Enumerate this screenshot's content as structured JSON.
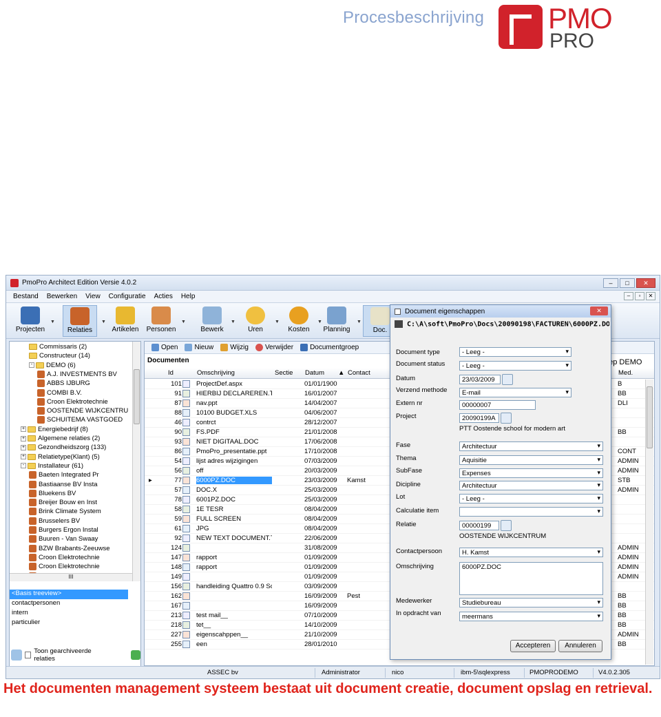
{
  "header": {
    "doc_title": "Procesbeschrijving",
    "logo_top": "PMO",
    "logo_bottom": "PRO"
  },
  "window": {
    "title": "PmoPro Architect Edition Versie 4.0.2"
  },
  "menu": [
    "Bestand",
    "Bewerken",
    "View",
    "Configuratie",
    "Acties",
    "Help"
  ],
  "toolbar": [
    "Projecten",
    "Relaties",
    "Artikelen",
    "Personen",
    "Bewerk",
    "Uren",
    "Kosten",
    "Planning",
    "Doc."
  ],
  "tree": [
    {
      "label": "Commissaris (2)",
      "type": "folder",
      "indent": 2
    },
    {
      "label": "Constructeur (14)",
      "type": "folder",
      "indent": 2
    },
    {
      "label": "DEMO (6)",
      "type": "folder",
      "indent": 2,
      "expander": "-"
    },
    {
      "label": "A.J. INVESTMENTS BV",
      "type": "person",
      "indent": 3
    },
    {
      "label": "ABBS IJBURG",
      "type": "person",
      "indent": 3
    },
    {
      "label": "COMBI B.V.",
      "type": "person",
      "indent": 3
    },
    {
      "label": "Croon Elektrotechnie",
      "type": "person",
      "indent": 3
    },
    {
      "label": "OOSTENDE WIJKCENTRU",
      "type": "person",
      "indent": 3
    },
    {
      "label": "SCHUITEMA VASTGOED",
      "type": "person",
      "indent": 3
    },
    {
      "label": "Energiebedrijf (8)",
      "type": "folder",
      "indent": 1,
      "expander": "+"
    },
    {
      "label": "Algemene relaties (2)",
      "type": "folder",
      "indent": 1,
      "expander": "+"
    },
    {
      "label": "Gezondheidszorg (133)",
      "type": "folder",
      "indent": 1,
      "expander": "+"
    },
    {
      "label": "Relatietype(Klant) (5)",
      "type": "folder",
      "indent": 1,
      "expander": "+"
    },
    {
      "label": "Installateur (61)",
      "type": "folder",
      "indent": 1,
      "expander": "-"
    },
    {
      "label": "Baeten Integrated Pr",
      "type": "person",
      "indent": 2
    },
    {
      "label": "Bastiaanse BV  Insta",
      "type": "person",
      "indent": 2
    },
    {
      "label": "Bluekens BV",
      "type": "person",
      "indent": 2
    },
    {
      "label": "Breijer Bouw en Inst",
      "type": "person",
      "indent": 2
    },
    {
      "label": "Brink Climate System",
      "type": "person",
      "indent": 2
    },
    {
      "label": "Brusselers BV",
      "type": "person",
      "indent": 2
    },
    {
      "label": "Burgers Ergon Instal",
      "type": "person",
      "indent": 2
    },
    {
      "label": "Buuren - Van Swaay",
      "type": "person",
      "indent": 2
    },
    {
      "label": "BZW Brabants-Zeeuwse",
      "type": "person",
      "indent": 2
    },
    {
      "label": "Croon Elektrotechnie",
      "type": "person",
      "indent": 2
    },
    {
      "label": "Croon Elektrotechnie",
      "type": "person",
      "indent": 2
    },
    {
      "label": "Dalkia Installatiete",
      "type": "person",
      "indent": 2
    }
  ],
  "tree_hscroll": "III",
  "lower_list": {
    "selected": "<Basis treeview>",
    "items": [
      "contactpersonen",
      "intern",
      "particulier"
    ]
  },
  "archive_checkbox": "Toon gearchiveerde relaties",
  "doc_toolbar": [
    "Open",
    "Nieuw",
    "Wijzig",
    "Verwijder",
    "Documentgroep"
  ],
  "grid": {
    "title": "Documenten",
    "right_title": "bep DEMO",
    "columns": [
      "Id",
      "Omschrijving",
      "Sectie",
      "Datum",
      "Contact",
      "Med."
    ],
    "rows": [
      {
        "id": "101",
        "om": "ProjectDef.aspx",
        "datum": "01/01/1900",
        "contact": "",
        "med": "B"
      },
      {
        "id": "91",
        "om": "HIERBIJ DECLAREREN.TX",
        "datum": "16/01/2007",
        "contact": "",
        "med": "BB"
      },
      {
        "id": "87",
        "om": "nav.ppt",
        "datum": "14/04/2007",
        "contact": "",
        "med": "DLI"
      },
      {
        "id": "88",
        "om": "10100 BUDGET.XLS",
        "datum": "04/06/2007",
        "contact": "",
        "med": ""
      },
      {
        "id": "46",
        "om": "contrct",
        "datum": "28/12/2007",
        "contact": "",
        "med": ""
      },
      {
        "id": "90",
        "om": "FS.PDF",
        "datum": "21/01/2008",
        "contact": "",
        "med": "BB"
      },
      {
        "id": "93",
        "om": "NIET DIGITAAL.DOC",
        "datum": "17/06/2008",
        "contact": "",
        "med": ""
      },
      {
        "id": "86",
        "om": "PmoPro_presentatie.ppt",
        "datum": "17/10/2008",
        "contact": "",
        "med": "CONT"
      },
      {
        "id": "54",
        "om": "lijst adres wijzigingen",
        "datum": "07/03/2009",
        "contact": "",
        "med": "ADMIN"
      },
      {
        "id": "56",
        "om": "off",
        "datum": "20/03/2009",
        "contact": "",
        "med": "ADMIN"
      },
      {
        "id": "77",
        "om": "6000PZ.DOC",
        "datum": "23/03/2009",
        "contact": "Kamst",
        "med": "STB",
        "selected": true
      },
      {
        "id": "57",
        "om": "DOC.X",
        "datum": "25/03/2009",
        "contact": "",
        "med": "ADMIN"
      },
      {
        "id": "78",
        "om": "6001PZ.DOC",
        "datum": "25/03/2009",
        "contact": "",
        "med": ""
      },
      {
        "id": "58",
        "om": "1E TESR",
        "datum": "08/04/2009",
        "contact": "",
        "med": ""
      },
      {
        "id": "59",
        "om": "FULL SCREEN",
        "datum": "08/04/2009",
        "contact": "",
        "med": ""
      },
      {
        "id": "61",
        "om": "JPG",
        "datum": "08/04/2009",
        "contact": "",
        "med": ""
      },
      {
        "id": "92",
        "om": "NEW TEXT DOCUMENT.T",
        "datum": "22/06/2009",
        "contact": "",
        "med": ""
      },
      {
        "id": "124",
        "om": "",
        "datum": "31/08/2009",
        "contact": "",
        "med": "ADMIN"
      },
      {
        "id": "147",
        "om": "rapport",
        "datum": "01/09/2009",
        "contact": "",
        "med": "ADMIN"
      },
      {
        "id": "148",
        "om": "rapport",
        "datum": "01/09/2009",
        "contact": "",
        "med": "ADMIN"
      },
      {
        "id": "149",
        "om": "",
        "datum": "01/09/2009",
        "contact": "",
        "med": "ADMIN"
      },
      {
        "id": "156",
        "om": "handleiding Quattro 0.9 Sca",
        "datum": "03/09/2009",
        "contact": "",
        "med": ""
      },
      {
        "id": "162",
        "om": "",
        "datum": "16/09/2009",
        "contact": "Pest",
        "med": "BB"
      },
      {
        "id": "167",
        "om": "",
        "datum": "16/09/2009",
        "contact": "",
        "med": "BB"
      },
      {
        "id": "213",
        "om": "test mail__",
        "datum": "07/10/2009",
        "contact": "",
        "med": "BB"
      },
      {
        "id": "218",
        "om": "tet__",
        "datum": "14/10/2009",
        "contact": "",
        "med": "BB"
      },
      {
        "id": "227",
        "om": "eigenscahppen__",
        "datum": "21/10/2009",
        "contact": "",
        "med": "ADMIN"
      },
      {
        "id": "255",
        "om": "een",
        "datum": "28/01/2010",
        "contact": "",
        "med": "BB"
      }
    ]
  },
  "status": {
    "company": "ASSEC bv",
    "user_role": "Administrator",
    "user": "nico",
    "server": "ibm-5\\sqlexpress",
    "database": "PMOPRODEMO",
    "version": "V4.0.2.305"
  },
  "dialog": {
    "title": "Document eigenschappen",
    "path": "C:\\A\\soft\\PmoPro\\Docs\\20090198\\FACTUREN\\6000PZ.DOC",
    "document_type_label": "Document type",
    "document_type": "- Leeg -",
    "document_status_label": "Document status",
    "document_status": "- Leeg -",
    "datum_label": "Datum",
    "datum": "23/03/2009",
    "verzend_label": "Verzend methode",
    "verzend": "E-mail",
    "extern_label": "Extern nr",
    "extern": "00000007",
    "project_label": "Project",
    "project": "20090199A",
    "project_name": "PTT Oostende  school for modern art",
    "fase_label": "Fase",
    "fase": "Architectuur",
    "thema_label": "Thema",
    "thema": "Aquisitie",
    "subfase_label": "SubFase",
    "subfase": "Expenses",
    "dicipline_label": "Dicipline",
    "dicipline": "Architectuur",
    "lot_label": "Lot",
    "lot": "- Leeg -",
    "calc_label": "Calculatie item",
    "calc": "",
    "relatie_label": "Relatie",
    "relatie": "00000199",
    "relatie_name": "OOSTENDE WIJKCENTRUM",
    "contact_label": "Contactpersoon",
    "contact": "H. Kamst",
    "omschrijving_label": "Omschrijving",
    "omschrijving": "6000PZ.DOC",
    "medewerker_label": "Medewerker",
    "medewerker": "Studiebureau",
    "opdracht_label": "In opdracht van",
    "opdracht": "meermans",
    "accept_button": "Accepteren",
    "cancel_button": "Annuleren"
  },
  "caption": "Het documenten management systeem bestaat uit document creatie, document opslag en retrieval."
}
